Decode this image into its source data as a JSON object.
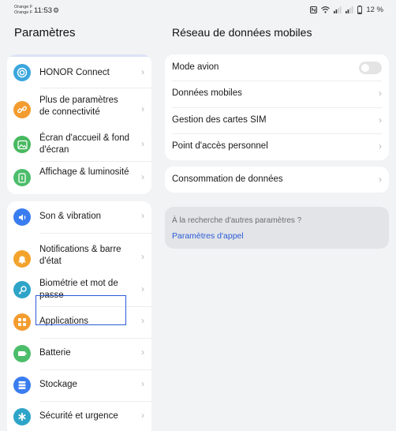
{
  "status_bar": {
    "carrier_1": "Orange F",
    "carrier_2": "Orange F",
    "time": "11:53",
    "battery": "12 %"
  },
  "left_panel": {
    "title": "Paramètres",
    "items": [
      {
        "label": "HONOR Connect",
        "icon": "honor-connect-icon",
        "color": "#3aa6dd"
      },
      {
        "label": "Plus de paramètres de connectivité",
        "icon": "link-icon",
        "color": "#f39c2f"
      },
      {
        "label": "Écran d'accueil & fond d'écran",
        "icon": "image-icon",
        "color": "#47b85f"
      },
      {
        "label": "Affichage & luminosité",
        "icon": "display-icon",
        "color": "#4cbd6b"
      },
      {
        "label": "Son & vibration",
        "icon": "speaker-icon",
        "color": "#3a7df0"
      },
      {
        "label": "Notifications & barre d'état",
        "icon": "bell-icon",
        "color": "#f3a32c"
      },
      {
        "label": "Biométrie et mot de passe",
        "icon": "key-icon",
        "color": "#2ea4c8"
      },
      {
        "label": "Applications",
        "icon": "apps-icon",
        "color": "#f39c2f"
      },
      {
        "label": "Batterie",
        "icon": "battery-icon",
        "color": "#4cbd6b"
      },
      {
        "label": "Stockage",
        "icon": "storage-icon",
        "color": "#3a7df0"
      },
      {
        "label": "Sécurité et urgence",
        "icon": "emergency-icon",
        "color": "#2ea4c8"
      }
    ]
  },
  "right_panel": {
    "title": "Réseau de données mobiles",
    "group1": [
      {
        "label": "Mode avion",
        "control": "toggle",
        "on": false
      },
      {
        "label": "Données mobiles"
      },
      {
        "label": "Gestion des cartes SIM"
      },
      {
        "label": "Point d'accès personnel"
      }
    ],
    "group2": [
      {
        "label": "Consommation de données"
      }
    ],
    "hint": {
      "question": "À la recherche d'autres paramètres ?",
      "link": "Paramètres d'appel"
    }
  },
  "colors": {
    "accent": "#2a5bd7",
    "background": "#f1f3f5",
    "card": "#ffffff"
  }
}
